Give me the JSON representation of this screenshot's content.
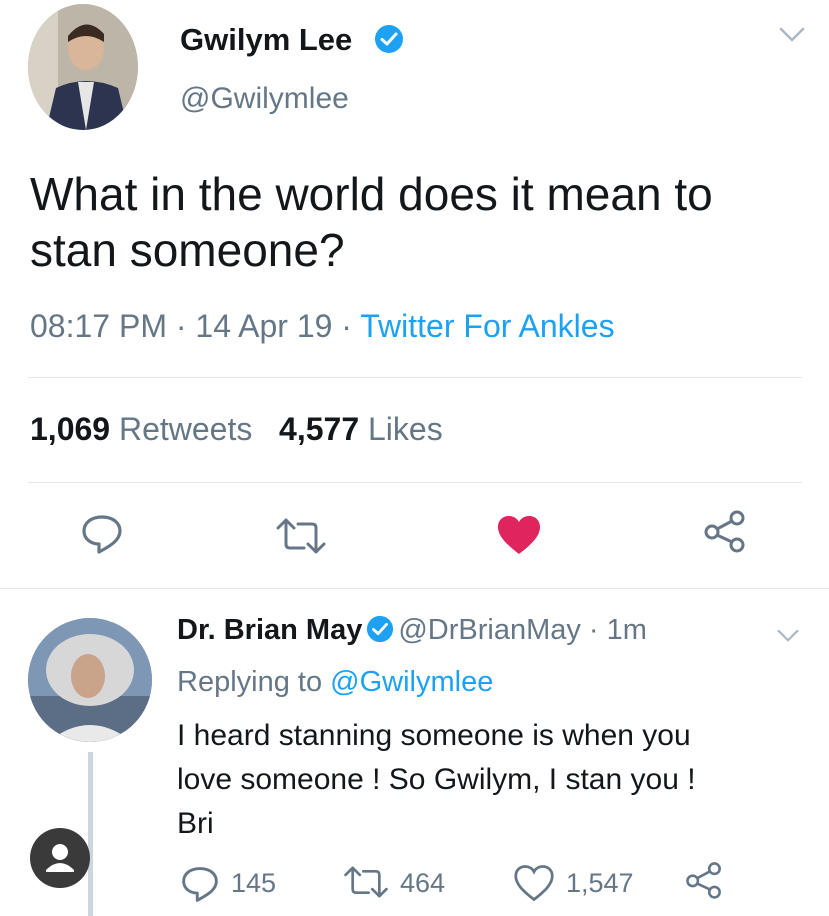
{
  "main_tweet": {
    "display_name": "Gwilym Lee",
    "handle": "@Gwilymlee",
    "text": "What in the world does it mean to stan someone?",
    "time": "08:17 PM",
    "date": "14 Apr 19",
    "client": "Twitter For Ankles",
    "retweets_count": "1,069",
    "retweets_label": "Retweets",
    "likes_count": "4,577",
    "likes_label": "Likes",
    "liked": true
  },
  "reply_tweet": {
    "display_name": "Dr. Brian May",
    "handle": "@DrBrianMay",
    "age": "1m",
    "replying_prefix": "Replying to",
    "replying_to": "@Gwilymlee",
    "text_lines": [
      "I heard stanning someone is when you",
      "love someone ! So Gwilym, I stan you !",
      "Bri"
    ],
    "reply_count": "145",
    "retweet_count": "464",
    "like_count": "1,547"
  },
  "colors": {
    "accent": "#1da1f2",
    "like": "#e0245e",
    "muted": "#657786",
    "text": "#14171a",
    "divider": "#e1e8ed"
  },
  "icons": {
    "verified": "verified-badge-icon",
    "chevron": "chevron-down-icon",
    "reply": "reply-bubble-icon",
    "retweet": "retweet-icon",
    "like": "heart-icon",
    "share": "share-icon",
    "profile": "profile-icon"
  }
}
